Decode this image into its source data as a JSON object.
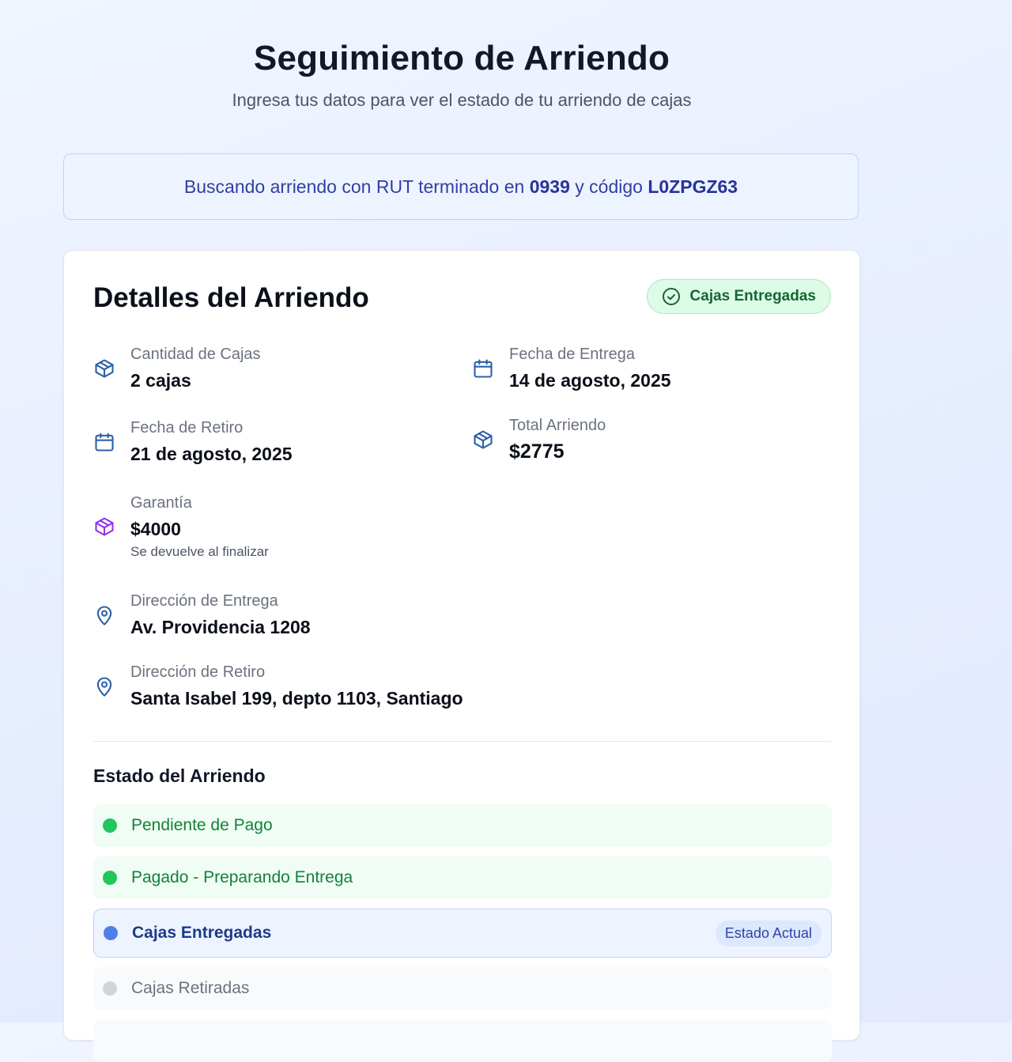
{
  "header": {
    "title": "Seguimiento de Arriendo",
    "subtitle": "Ingresa tus datos para ver el estado de tu arriendo de cajas"
  },
  "search": {
    "prefix": "Buscando arriendo con RUT terminado en",
    "rut_suffix": "0939",
    "connector": "y código",
    "code": "L0ZPGZ63"
  },
  "details": {
    "title": "Detalles del Arriendo",
    "status_badge": "Cajas Entregadas",
    "boxes": {
      "label": "Cantidad de Cajas",
      "value": "2 cajas",
      "icon": "package-icon"
    },
    "delivery_date": {
      "label": "Fecha de Entrega",
      "value": "14 de agosto, 2025",
      "icon": "calendar-icon"
    },
    "pickup_date": {
      "label": "Fecha de Retiro",
      "value": "21 de agosto, 2025",
      "icon": "calendar-icon"
    },
    "total": {
      "label": "Total Arriendo",
      "value": "$2775",
      "icon": "package-icon"
    },
    "deposit": {
      "label": "Garantía",
      "value": "$4000",
      "note": "Se devuelve al finalizar",
      "icon": "package-icon"
    },
    "delivery_address": {
      "label": "Dirección de Entrega",
      "value": "Av. Providencia 1208",
      "icon": "map-pin-icon"
    },
    "pickup_address": {
      "label": "Dirección de Retiro",
      "value": "Santa Isabel 199, depto 1103, Santiago",
      "icon": "map-pin-icon"
    }
  },
  "timeline": {
    "title": "Estado del Arriendo",
    "current_tag": "Estado Actual",
    "steps": [
      {
        "label": "Pendiente de Pago",
        "state": "done"
      },
      {
        "label": "Pagado - Preparando Entrega",
        "state": "done"
      },
      {
        "label": "Cajas Entregadas",
        "state": "current"
      },
      {
        "label": "Cajas Retiradas",
        "state": "pending"
      }
    ]
  },
  "colors": {
    "accent_blue": "#2b61a8",
    "deposit_purple": "#9333ea",
    "success_green": "#22c55e",
    "current_blue": "#4f7fea",
    "pending_gray": "#d1d5db"
  }
}
